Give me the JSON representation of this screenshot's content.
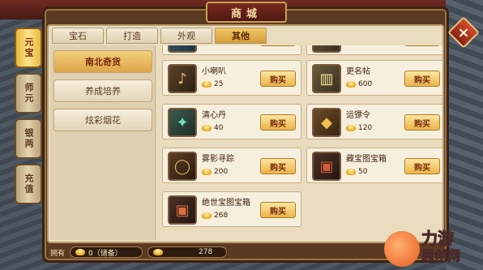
{
  "title": "商城",
  "close_icon": "×",
  "side_tabs": [
    {
      "label": "元宝",
      "active": true
    },
    {
      "label": "师元",
      "active": false
    },
    {
      "label": "银两",
      "active": false
    },
    {
      "label": "充值",
      "active": false
    }
  ],
  "top_tabs": [
    {
      "label": "宝石",
      "active": false
    },
    {
      "label": "打造",
      "active": false
    },
    {
      "label": "外观",
      "active": false
    },
    {
      "label": "其他",
      "active": true
    }
  ],
  "categories": [
    {
      "label": "南北奇货",
      "active": true
    },
    {
      "label": "养成培养",
      "active": false
    },
    {
      "label": "炫彩烟花",
      "active": false
    }
  ],
  "items": [
    {
      "name": "",
      "price": "",
      "buy": "购买",
      "icon": "scroll-icon"
    },
    {
      "name": "",
      "price": "",
      "buy": "购买",
      "icon": "book-icon"
    },
    {
      "name": "小喇叭",
      "price": "25",
      "buy": "购买",
      "icon": "horn-icon"
    },
    {
      "name": "更名帖",
      "price": "600",
      "buy": "购买",
      "icon": "rename-scroll-icon"
    },
    {
      "name": "清心丹",
      "price": "40",
      "buy": "购买",
      "icon": "pill-icon"
    },
    {
      "name": "运镖令",
      "price": "120",
      "buy": "购买",
      "icon": "token-icon"
    },
    {
      "name": "雾影寻踪",
      "price": "200",
      "buy": "购买",
      "icon": "ring-icon"
    },
    {
      "name": "藏宝图宝箱",
      "price": "50",
      "buy": "购买",
      "icon": "chest-icon"
    },
    {
      "name": "绝世宝图宝箱",
      "price": "268",
      "buy": "购买",
      "icon": "treasure-chest-icon"
    }
  ],
  "bottom": {
    "owned_label": "拥有",
    "owned_value": "0（储备）",
    "gold_value": "278"
  },
  "watermark": {
    "line1": "力游",
    "line2": "思创网"
  }
}
